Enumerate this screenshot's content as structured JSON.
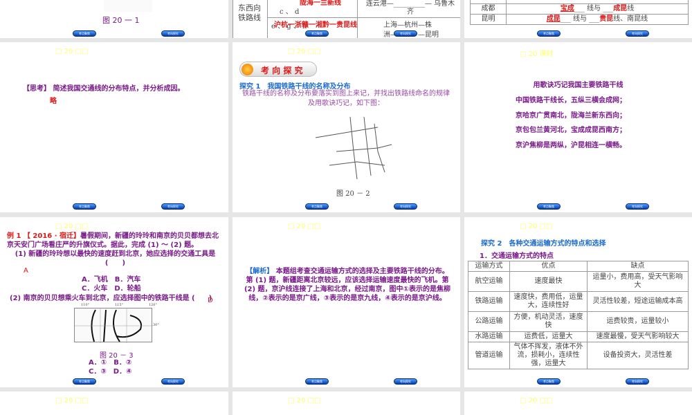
{
  "header": "□ 20 □□",
  "header_alt": "□ 20 课时",
  "nav": {
    "prev": "考点聚焦",
    "next": "考向探究"
  },
  "s0": {
    "caption": "图 20 一 1"
  },
  "s1": {
    "row_label": "东西向铁路线",
    "cd": "c 、 d",
    "cd_answer": "陇海一兰新线",
    "eh": "e 、 g 、 h",
    "eh_answer": "沪杭一浙赣一湘黔一贵昆线",
    "r1": "连云港—_________— 乌鲁木齐",
    "r2a": "上海—杭州—株",
    "r2b": "洲—",
    "r2c": "—昆明"
  },
  "s2": {
    "rows": [
      {
        "city": "成都",
        "a": "宝成",
        "mid": "线与",
        "b": "成昆",
        "tail": "线"
      },
      {
        "city": "昆明",
        "a": "成昆",
        "mid": "线与",
        "b": "贵昆",
        "tail": "线、南昆线"
      }
    ]
  },
  "s3": {
    "question": "【思考】 简述我国交通线的分布特点，并分析成因。",
    "answer": "略"
  },
  "s4": {
    "banner": "考 向 探 究",
    "title": "探究 1　我国铁路干线的名称及分布",
    "text": "铁路干线的名称及分布要落实到图上来记，并找出铁路线命名的规律及用歌诀巧记，如下图：",
    "caption": "图 20 － 2"
  },
  "s5": {
    "title": "用歌诀巧记我国主要铁路干线",
    "lines": [
      "中国铁路干线长，五纵三横会成网；",
      "京哈京广贯南北，陇海兰新东西向；",
      "京包包兰黄河北，宝成成昆西南方；",
      "京沪焦柳是两纵，沪昆相连一横畅。"
    ]
  },
  "s6": {
    "label": "例 1 【 2016 · 宿迁】",
    "intro": "暑假期间，新疆的玲玲和南京的贝贝都想去北京天安门广场看庄严的升旗仪式。据此，完成 (1) ～ (2) 题。",
    "q1": "(1) 新疆的玲玲想以最快的速度赶到北京，她应选择的交通工具是 (　　)",
    "a1": "A",
    "opts1": [
      "A．飞机　B．汽车",
      "C．火车　D．轮船"
    ],
    "q2": "(2) 南京的贝贝想乘火车到北京，应选择图中的铁路干线是 (　　)",
    "a2": "D",
    "caption": "图 20 － 3",
    "opts2": [
      "A．①　B．②",
      "C．③　D．④"
    ],
    "map_ticks": [
      "110°",
      "115°",
      "120°",
      "30°"
    ]
  },
  "s7": {
    "label": "【解析】",
    "text": "本题组考查交通运输方式的选择及主要铁路干线的分布。第 (1) 题，新疆距离北京较远，应该选择运输速度最快的飞机。第 (2) 题，京沪线连接了上海和北京，经过南京，图中①表示的是焦柳线，②表示的是京广线，③表示的是京九线，④表示的是京沪线。"
  },
  "s8": {
    "title": "探究 2　各种交通运输方式的特点和选择",
    "subtitle": "1．交通运输方式的特点",
    "headers": [
      "运输方式",
      "优点",
      "缺点"
    ],
    "rows": [
      [
        "航空运输",
        "速度最快",
        "运量小，费用高，受天气影响大"
      ],
      [
        "铁路运输",
        "速度快，费用低，运量大，连续性好",
        "灵活性较差，短途运输成本高"
      ],
      [
        "公路运输",
        "方便，机动灵活，速度快",
        "运费较贵，运量较小"
      ],
      [
        "水路运输",
        "运费低，运量大",
        "速度最慢，受天气影响较大"
      ],
      [
        "管道运输",
        "气体不挥发，液体不外流，损耗小，连续性强，运量大",
        "设备投资大，灵活性差"
      ]
    ]
  }
}
